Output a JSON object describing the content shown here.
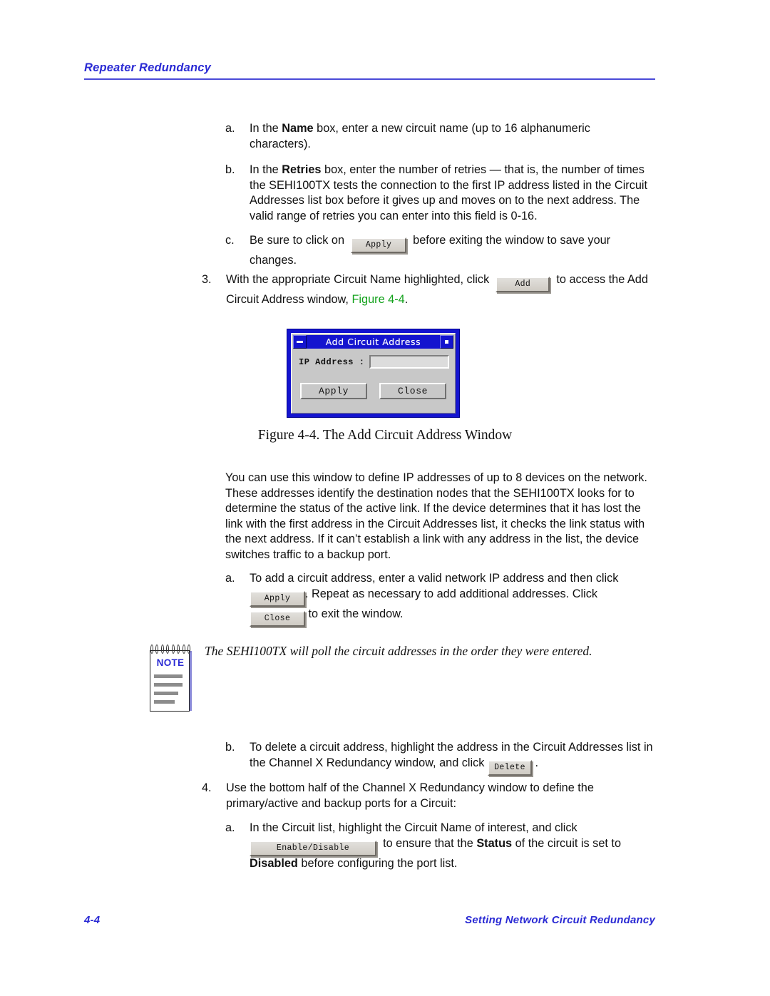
{
  "header": {
    "title": "Repeater Redundancy"
  },
  "footer": {
    "page_number": "4-4",
    "section_title": "Setting Network Circuit Redundancy"
  },
  "buttons": {
    "apply": "Apply",
    "add": "Add",
    "close": "Close",
    "delete": "Delete",
    "enable_disable": "Enable/Disable"
  },
  "steps": {
    "a1_marker": "a.",
    "a1_text_pre": "In the ",
    "a1_bold": "Name",
    "a1_text_post": " box, enter a new circuit name (up to 16 alphanumeric characters).",
    "b1_marker": "b.",
    "b1_text_pre": "In the ",
    "b1_bold": "Retries",
    "b1_text_post": " box, enter the number of retries — that is, the number of times the SEHI100TX tests the connection to the first IP address listed in the Circuit Addresses list box before it gives up and moves on to the next address. The valid range of retries you can enter into this field is 0-16.",
    "c1_marker": "c.",
    "c1_text_pre": "Be sure to click on",
    "c1_text_post": "before exiting the window to save your changes.",
    "s3_marker": "3.",
    "s3_text_pre": "With the appropriate Circuit Name highlighted, click",
    "s3_text_mid": "to access the Add Circuit Address window, ",
    "s3_link": "Figure 4-4",
    "s3_text_end": ".",
    "para1": "You can use this window to define IP addresses of up to 8 devices on the network. These addresses identify the destination nodes that the SEHI100TX looks for to determine the status of the active link. If the device determines that it has lost the link with the first address in the Circuit Addresses list, it checks the link status with the next address. If it can’t establish a link with any address in the list, the device switches traffic to a backup port.",
    "a2_marker": "a.",
    "a2_text_pre": "To add a circuit address, enter a valid network IP address and then click",
    "a2_text_mid": ". Repeat as necessary to add additional addresses. Click",
    "a2_text_end": "to exit the window.",
    "b2_marker": "b.",
    "b2_text_pre": "To delete a circuit address, highlight the address in the Circuit Addresses list in the Channel X Redundancy window, and click",
    "b2_text_end": ".",
    "s4_marker": "4.",
    "s4_text": "Use the bottom half of the Channel X Redundancy window to define the primary/active and backup ports for a Circuit:",
    "a3_marker": "a.",
    "a3_text_pre": "In the Circuit list, highlight the Circuit Name of interest, and click",
    "a3_text_mid": "to ensure that the ",
    "a3_bold1": "Status",
    "a3_text_mid2": " of the circuit is set to ",
    "a3_bold2": "Disabled",
    "a3_text_end": " before configuring the port list."
  },
  "note": {
    "label": "NOTE",
    "text": "The SEHI100TX will poll the circuit addresses in the order they were entered."
  },
  "figure": {
    "caption": "Figure 4-4.  The Add Circuit Address Window",
    "dialog": {
      "title": "Add Circuit Address",
      "ip_label": "IP Address :",
      "ip_value": "",
      "apply_label": "Apply",
      "close_label": "Close"
    }
  },
  "colors": {
    "header_blue": "#2b2bd4",
    "link_green": "#11a11a",
    "dialog_blue": "#1414cf",
    "dialog_face": "#c8c8c8"
  }
}
